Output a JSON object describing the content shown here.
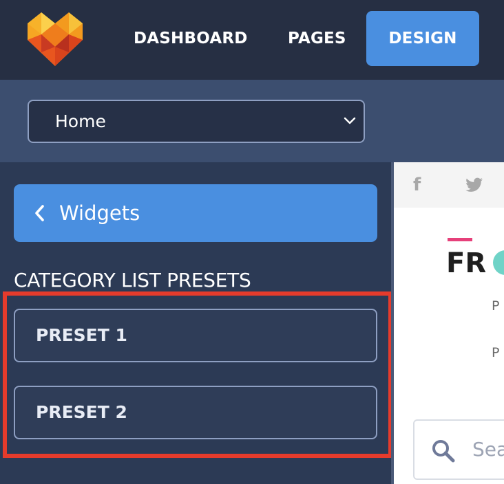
{
  "nav": {
    "items": [
      {
        "label": "DASHBOARD"
      },
      {
        "label": "PAGES"
      },
      {
        "label": "DESIGN",
        "active": true
      }
    ],
    "accent_color": "#4a8fe0"
  },
  "page_selector": {
    "selected": "Home",
    "icon": "chevron-down-icon"
  },
  "sidebar": {
    "back_button_label": "Widgets",
    "back_icon": "chevron-left-icon",
    "section_title": "CATEGORY LIST PRESETS",
    "presets": [
      {
        "label": "PRESET 1"
      },
      {
        "label": "PRESET 2"
      }
    ],
    "highlight_color": "#e53b2c"
  },
  "preview": {
    "social_icons": [
      "facebook-icon",
      "twitter-icon"
    ],
    "brand_text": "FR",
    "paragraph_1": "P",
    "paragraph_2": "P",
    "search_text": "Sea"
  }
}
